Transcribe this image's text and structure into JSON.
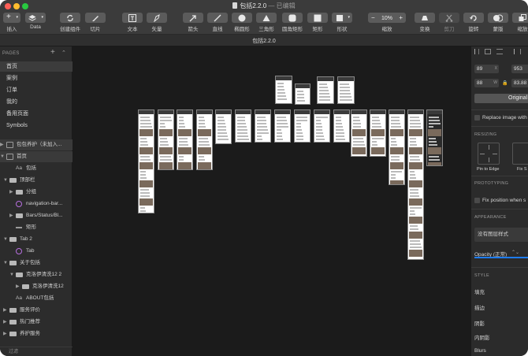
{
  "window": {
    "title": "包括2.2.0",
    "subtitle": " — 已编辑",
    "doc_tab": "包括2.2.0",
    "colors": {
      "close": "#fe5f57",
      "minimize": "#febc2e",
      "zoom": "#28c840"
    }
  },
  "toolbar": {
    "insert": "插入",
    "data": "Data",
    "create_symbol": "创建组件",
    "slice": "切片",
    "text": "文本",
    "vector": "矢量",
    "arrow": "箭头",
    "line": "直线",
    "oval": "椭圆形",
    "triangle": "三角形",
    "rounded_rect": "圆角矩形",
    "rectangle": "矩形",
    "shape": "形状",
    "zoom": "缩放",
    "zoom_value": "10%",
    "transform": "变换",
    "scissors": "剪刀",
    "rotate": "旋转",
    "mask": "蒙版",
    "scale": "缩放"
  },
  "sidebar": {
    "pages_label": "PAGES",
    "pages": [
      "首页",
      "案例",
      "订单",
      "我的",
      "备用页面",
      "Symbols"
    ],
    "layers": [
      {
        "name": "包包养护（未加入...",
        "icon": "artboard",
        "indent": 0,
        "expanded": false,
        "highlight": true
      },
      {
        "name": "首页",
        "icon": "artboard",
        "indent": 0,
        "expanded": true,
        "highlight": true
      },
      {
        "name": "包括",
        "icon": "text",
        "indent": 1,
        "expanded": null
      },
      {
        "name": "顶部栏",
        "icon": "folder",
        "indent": 0,
        "expanded": true
      },
      {
        "name": "分组",
        "icon": "folder",
        "indent": 1,
        "expanded": false
      },
      {
        "name": "navigation-bar...",
        "icon": "symbol",
        "indent": 1,
        "expanded": null
      },
      {
        "name": "Bars/Status/Bl...",
        "icon": "folder",
        "indent": 1,
        "expanded": false
      },
      {
        "name": "矩形",
        "icon": "rect",
        "indent": 1,
        "expanded": null
      },
      {
        "name": "Tab 2",
        "icon": "folder",
        "indent": 0,
        "expanded": true
      },
      {
        "name": "Tab",
        "icon": "symbol",
        "indent": 1,
        "expanded": null
      },
      {
        "name": "关于包括",
        "icon": "folder",
        "indent": 0,
        "expanded": true
      },
      {
        "name": "克洛伊清洗12 2",
        "icon": "folder",
        "indent": 1,
        "expanded": true
      },
      {
        "name": "克洛伊清洗12",
        "icon": "folder",
        "indent": 2,
        "expanded": false
      },
      {
        "name": "ABOUT包括",
        "icon": "text",
        "indent": 1,
        "expanded": null
      },
      {
        "name": "服务评价",
        "icon": "folder",
        "indent": 0,
        "expanded": false
      },
      {
        "name": "热门推荐",
        "icon": "folder",
        "indent": 0,
        "expanded": false
      },
      {
        "name": "养护服务",
        "icon": "folder",
        "indent": 0,
        "expanded": false
      }
    ],
    "filter_label": "过滤"
  },
  "inspector": {
    "x": "89",
    "x_unit": "X",
    "y": "953",
    "w": "88",
    "w_unit": "W",
    "h": "83.88",
    "original_button": "Original",
    "replace_image": "Replace image with",
    "resizing": "RESIZING",
    "pin_to_edge": "Pin to Edge",
    "fix_size": "Fix S",
    "prototyping": "PROTOTYPING",
    "fix_position": "Fix position when s",
    "appearance": "APPEARANCE",
    "no_layer_style": "没有图层样式",
    "opacity": "Opacity (正常)",
    "style": "STYLE",
    "fill": "填充",
    "border": "描边",
    "shadow": "阴影",
    "inner_shadow": "内阴影",
    "blurs": "Blurs"
  }
}
